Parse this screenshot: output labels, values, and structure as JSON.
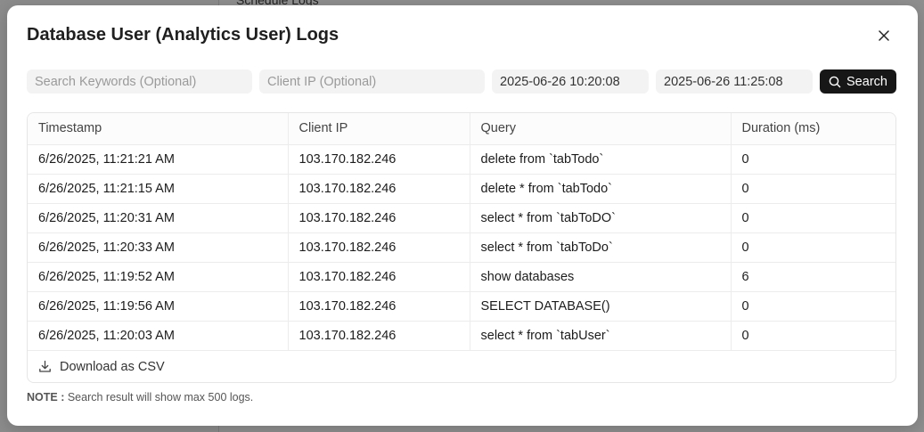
{
  "background": {
    "peek_text": "Schedule Logs"
  },
  "modal": {
    "title": "Database User (Analytics User) Logs",
    "close_icon": "close-icon"
  },
  "filters": {
    "keywords_placeholder": "Search Keywords (Optional)",
    "keywords_value": "",
    "client_ip_placeholder": "Client IP (Optional)",
    "client_ip_value": "",
    "start_datetime": "2025-06-26 10:20:08",
    "end_datetime": "2025-06-26 11:25:08",
    "search_label": "Search",
    "search_icon": "search-icon"
  },
  "table": {
    "columns": [
      "Timestamp",
      "Client IP",
      "Query",
      "Duration (ms)"
    ],
    "rows": [
      [
        "6/26/2025, 11:21:21 AM",
        "103.170.182.246",
        "delete from `tabTodo`",
        "0"
      ],
      [
        "6/26/2025, 11:21:15 AM",
        "103.170.182.246",
        "delete * from `tabTodo`",
        "0"
      ],
      [
        "6/26/2025, 11:20:31 AM",
        "103.170.182.246",
        "select * from `tabToDO`",
        "0"
      ],
      [
        "6/26/2025, 11:20:33 AM",
        "103.170.182.246",
        "select * from `tabToDo`",
        "0"
      ],
      [
        "6/26/2025, 11:19:52 AM",
        "103.170.182.246",
        "show databases",
        "6"
      ],
      [
        "6/26/2025, 11:19:56 AM",
        "103.170.182.246",
        "SELECT DATABASE()",
        "0"
      ],
      [
        "6/26/2025, 11:20:03 AM",
        "103.170.182.246",
        "select * from `tabUser`",
        "0"
      ]
    ],
    "download_label": "Download as CSV",
    "download_icon": "download-icon"
  },
  "note": {
    "prefix": "NOTE :",
    "text": "Search result will show max 500 logs."
  }
}
